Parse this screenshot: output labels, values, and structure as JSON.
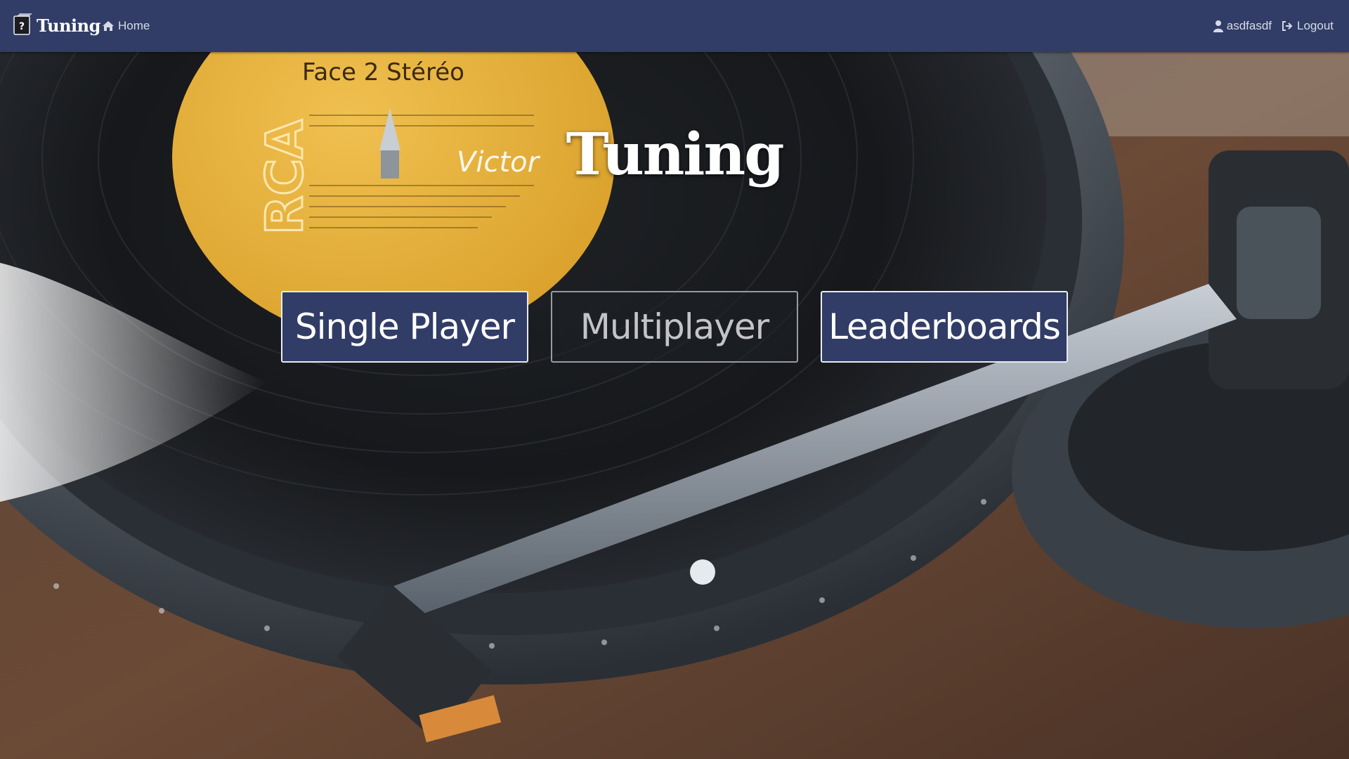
{
  "navbar": {
    "brand": "Tuning",
    "home_label": "Home",
    "user_label": "asdfasdf",
    "logout_label": "Logout",
    "color": "#313d67"
  },
  "hero": {
    "title": "Tuning",
    "buttons": {
      "single_player": "Single Player",
      "multiplayer": "Multiplayer",
      "leaderboards": "Leaderboards"
    }
  },
  "background": {
    "label_side": "Face 2 Stéréo",
    "label_brand": "RCA",
    "label_maker": "Victor"
  },
  "icons": {
    "brand": "record-sleeve-question-icon",
    "home": "home-icon",
    "user": "user-icon",
    "logout": "logout-icon"
  }
}
